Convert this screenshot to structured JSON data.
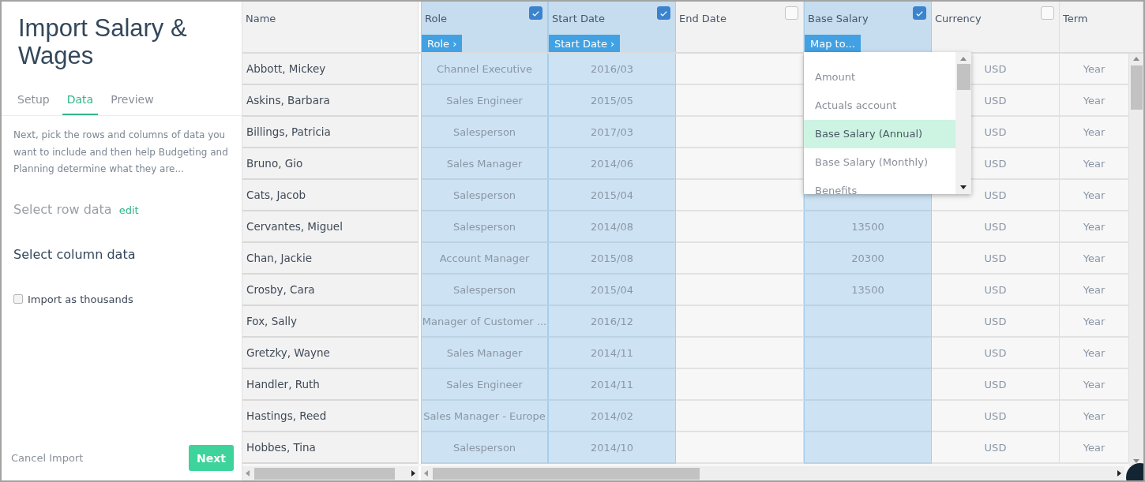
{
  "sidebar": {
    "title": "Import Salary & Wages",
    "tabs": [
      {
        "label": "Setup",
        "selected": false
      },
      {
        "label": "Data",
        "selected": true
      },
      {
        "label": "Preview",
        "selected": false
      }
    ],
    "description": "Next, pick the rows and columns of data you want to include and then help Budgeting and Planning determine what they are...",
    "row_section": {
      "label": "Select row data",
      "link": "edit"
    },
    "column_section": {
      "label": "Select column data"
    },
    "import_as_thousands": {
      "label": "Import as thousands",
      "checked": false
    },
    "cancel": "Cancel Import",
    "next": "Next"
  },
  "table": {
    "columns": [
      {
        "label": "Name"
      },
      {
        "label": "Role",
        "checked": true,
        "mapping": "Role ›"
      },
      {
        "label": "Start Date",
        "checked": true,
        "mapping": "Start Date ›"
      },
      {
        "label": "End Date",
        "checked": false
      },
      {
        "label": "Base Salary",
        "checked": true,
        "mapping": "Map to..."
      },
      {
        "label": "Currency",
        "checked": false
      },
      {
        "label": "Term"
      }
    ],
    "rows": [
      {
        "name": "Abbott, Mickey",
        "role": "Channel Executive",
        "start_date": "2016/03",
        "currency": "USD",
        "term": "Year"
      },
      {
        "name": "Askins, Barbara",
        "role": "Sales Engineer",
        "start_date": "2015/05",
        "currency": "USD",
        "term": "Year"
      },
      {
        "name": "Billings, Patricia",
        "role": "Salesperson",
        "start_date": "2017/03",
        "currency": "USD",
        "term": "Year"
      },
      {
        "name": "Bruno, Gio",
        "role": "Sales Manager",
        "start_date": "2014/06",
        "currency": "USD",
        "term": "Year"
      },
      {
        "name": "Cats, Jacob",
        "role": "Salesperson",
        "start_date": "2015/04",
        "currency": "USD",
        "term": "Year"
      },
      {
        "name": "Cervantes, Miguel",
        "role": "Salesperson",
        "start_date": "2014/08",
        "base_salary": "13500",
        "currency": "USD",
        "term": "Year"
      },
      {
        "name": "Chan, Jackie",
        "role": "Account Manager",
        "start_date": "2015/08",
        "base_salary": "20300",
        "currency": "USD",
        "term": "Year"
      },
      {
        "name": "Crosby, Cara",
        "role": "Salesperson",
        "start_date": "2015/04",
        "base_salary": "13500",
        "currency": "USD",
        "term": "Year"
      },
      {
        "name": "Fox, Sally",
        "role": "Manager of Customer ...",
        "start_date": "2016/12",
        "currency": "USD",
        "term": "Year"
      },
      {
        "name": "Gretzky, Wayne",
        "role": "Sales Manager",
        "start_date": "2014/11",
        "currency": "USD",
        "term": "Year"
      },
      {
        "name": "Handler, Ruth",
        "role": "Sales Engineer",
        "start_date": "2014/11",
        "currency": "USD",
        "term": "Year"
      },
      {
        "name": "Hastings, Reed",
        "role": "Sales Manager - Europe",
        "start_date": "2014/02",
        "currency": "USD",
        "term": "Year"
      },
      {
        "name": "Hobbes, Tina",
        "role": "Salesperson",
        "start_date": "2014/10",
        "currency": "USD",
        "term": "Year"
      }
    ],
    "dropdown": {
      "options": [
        {
          "label": "Amount",
          "selected": false
        },
        {
          "label": "Actuals account",
          "selected": false
        },
        {
          "label": "Base Salary (Annual)",
          "selected": true
        },
        {
          "label": "Base Salary (Monthly)",
          "selected": false
        },
        {
          "label": "Benefits",
          "selected": false
        }
      ]
    }
  }
}
